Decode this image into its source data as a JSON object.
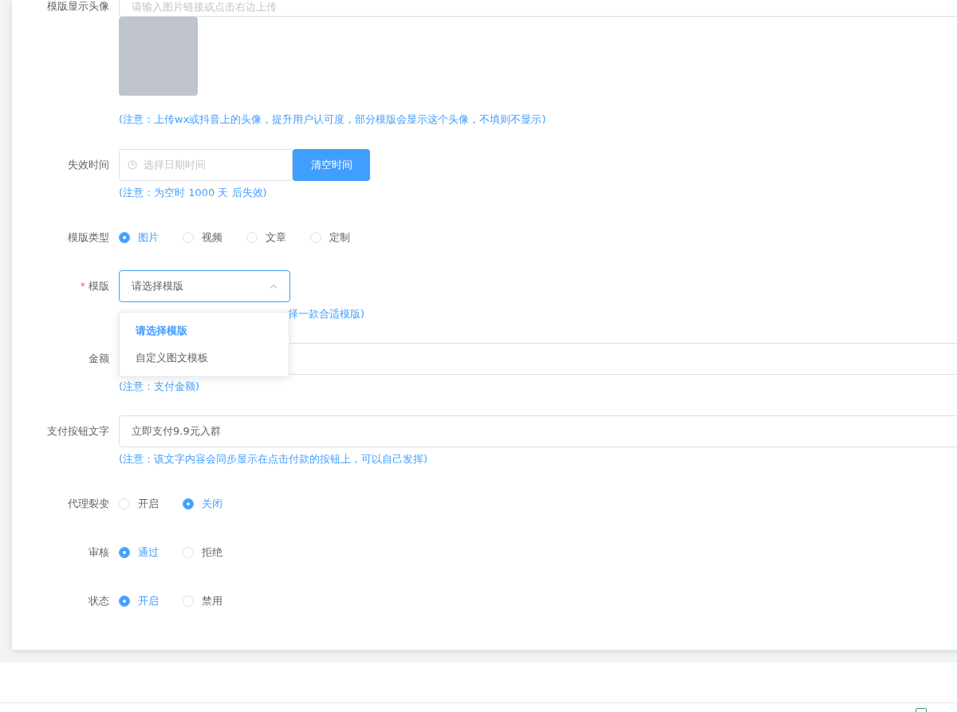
{
  "fields": [
    {
      "kind": "image-url",
      "label": "模版显示头像",
      "placeholder": "请输入图片链接或点击右边上传",
      "hint": "(注意：上传wx或抖音上的头像，提升用户认可度，部分模版会显示这个头像，不填则不显示)"
    },
    {
      "kind": "datetime",
      "label": "失效时间",
      "placeholder": "选择日期时间",
      "button": "清空时间",
      "hint": "(注意：为空时 1000 天 后失效)"
    },
    {
      "kind": "radio",
      "label": "模版类型",
      "options": [
        {
          "label": "图片",
          "selected": true
        },
        {
          "label": "视频",
          "selected": false
        },
        {
          "label": "文章",
          "selected": false
        },
        {
          "label": "定制",
          "selected": false
        }
      ]
    },
    {
      "kind": "select",
      "label": "模版",
      "required_mark": "*",
      "value": "请选择模版",
      "hint": "择一款合适模版)",
      "dropdown": {
        "expanded": true,
        "options": [
          {
            "label": "请选择模版",
            "selected": true
          },
          {
            "label": "自定义图文模板",
            "selected": false
          }
        ]
      }
    },
    {
      "kind": "text",
      "label": "金额",
      "hint": "(注意：支付金额)"
    },
    {
      "kind": "text",
      "label": "支付按钮文字",
      "value": "立即支付9.9元入群",
      "hint": "(注意：该文字内容会同步显示在点击付款的按钮上，可以自己发挥)"
    },
    {
      "kind": "radio",
      "label": "代理裂变",
      "options": [
        {
          "label": "开启",
          "selected": false
        },
        {
          "label": "关闭",
          "selected": true
        }
      ]
    },
    {
      "kind": "radio",
      "label": "审核",
      "options": [
        {
          "label": "通过",
          "selected": true
        },
        {
          "label": "拒绝",
          "selected": false
        }
      ]
    },
    {
      "kind": "radio",
      "label": "状态",
      "options": [
        {
          "label": "开启",
          "selected": true
        },
        {
          "label": "禁用",
          "selected": false
        }
      ]
    }
  ]
}
